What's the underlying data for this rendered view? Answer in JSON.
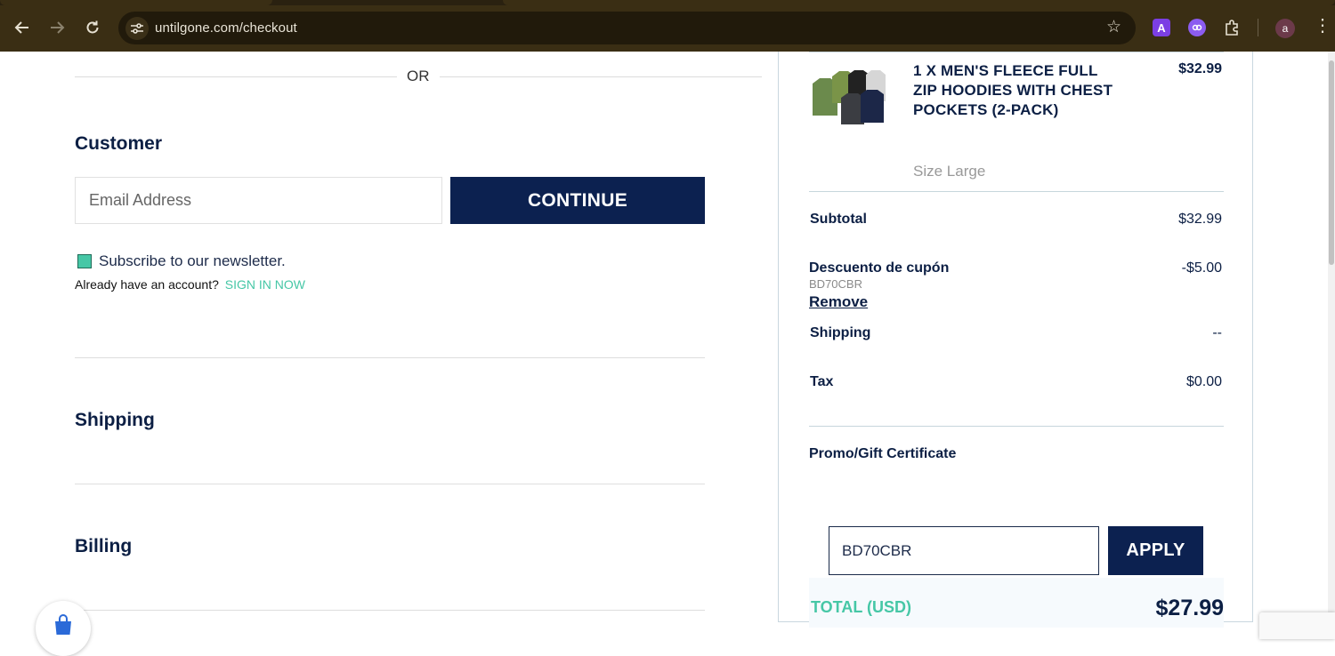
{
  "browser": {
    "url": "untilgone.com/checkout",
    "extensions": [
      "translate-icon",
      "purple-extension-icon",
      "puzzle-extension-icon"
    ],
    "profile_initial": "a"
  },
  "checkout": {
    "or_text": "OR",
    "customer": {
      "heading": "Customer",
      "email_placeholder": "Email Address",
      "continue_label": "CONTINUE",
      "newsletter_label": "Subscribe to our newsletter.",
      "newsletter_checked": true,
      "account_prompt": "Already have an account?",
      "signin_label": "SIGN IN NOW"
    },
    "shipping_heading": "Shipping",
    "billing_heading": "Billing"
  },
  "summary": {
    "product": {
      "name": "1 X MEN'S FLEECE FULL ZIP HOODIES WITH CHEST POCKETS (2-PACK)",
      "price": "$32.99",
      "size": "Size Large"
    },
    "subtotal_label": "Subtotal",
    "subtotal_value": "$32.99",
    "coupon_label": "Descuento de cupón",
    "coupon_code": "BD70CBR",
    "coupon_value": "-$5.00",
    "remove_label": "Remove",
    "shipping_label": "Shipping",
    "shipping_value": "--",
    "tax_label": "Tax",
    "tax_value": "$0.00",
    "promo_label": "Promo/Gift Certificate",
    "promo_value": "BD70CBR",
    "apply_label": "APPLY",
    "total_label": "TOTAL (USD)",
    "total_value": "$27.99"
  },
  "colors": {
    "navy": "#0c2150",
    "accent_green": "#46c7a6",
    "chrome_bg": "#3a2e14"
  }
}
